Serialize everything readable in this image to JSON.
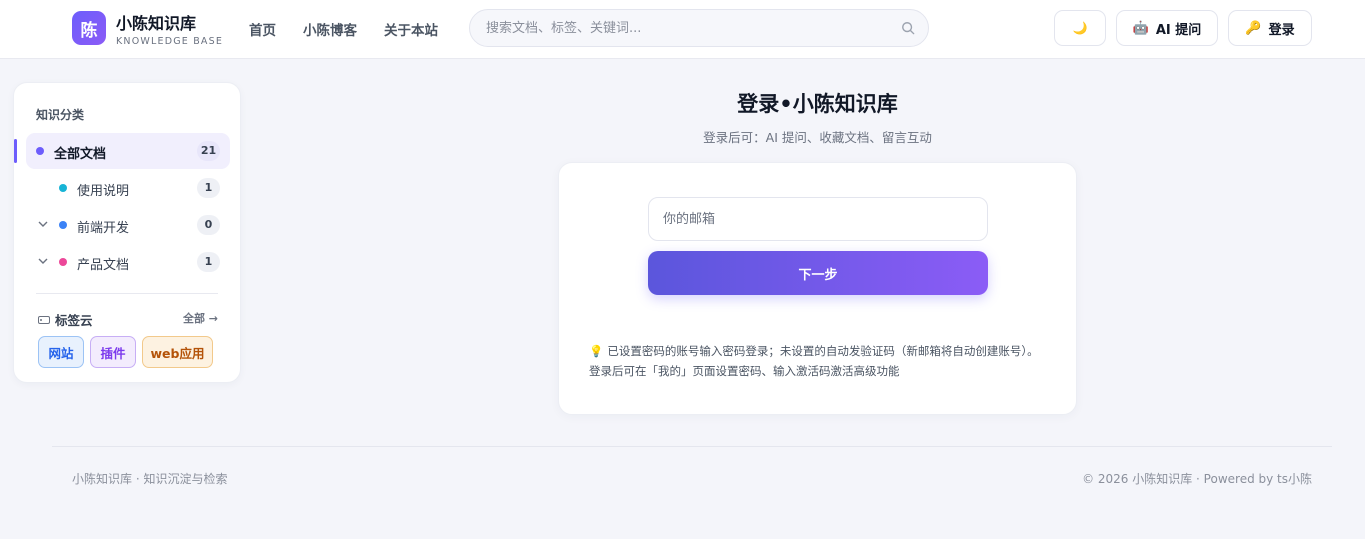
{
  "header": {
    "logo_char": "陈",
    "brand_title": "小陈知识库",
    "brand_sub": "KNOWLEDGE BASE",
    "nav": [
      "首页",
      "小陈博客",
      "关于本站"
    ],
    "search_placeholder": "搜索文档、标签、关键词...",
    "theme_icon": "🌙",
    "ai_icon": "🤖",
    "ai_label": "AI 提问",
    "login_icon": "🔑",
    "login_label": "登录"
  },
  "sidebar": {
    "heading": "知识分类",
    "categories": [
      {
        "label": "全部文档",
        "count": "21",
        "color": "#6d5dfc"
      },
      {
        "label": "使用说明",
        "count": "1",
        "color": "#17b4d6"
      },
      {
        "label": "前端开发",
        "count": "0",
        "color": "#3b82f6"
      },
      {
        "label": "产品文档",
        "count": "1",
        "color": "#ec4899"
      }
    ],
    "tag_heading": "标签云",
    "tag_all": "全部 →",
    "tags": [
      "网站",
      "插件",
      "web应用"
    ]
  },
  "main": {
    "title": "登录•小陈知识库",
    "subtitle": "登录后可：AI 提问、收藏文档、留言互动",
    "email_placeholder": "你的邮箱",
    "next_label": "下一步",
    "hint_line1": "已设置密码的账号输入密码登录；未设置的自动发验证码（新邮箱将自动创建账号）。",
    "hint_line2": "登录后可在「我的」页面设置密码、输入激活码激活高级功能"
  },
  "footer": {
    "left": "小陈知识库 · 知识沉淀与检索",
    "right": "© 2026 小陈知识库 · Powered by ts小陈"
  },
  "colors": {
    "accent": "#6d5dfc",
    "page_bg": "#f4f5fa"
  }
}
